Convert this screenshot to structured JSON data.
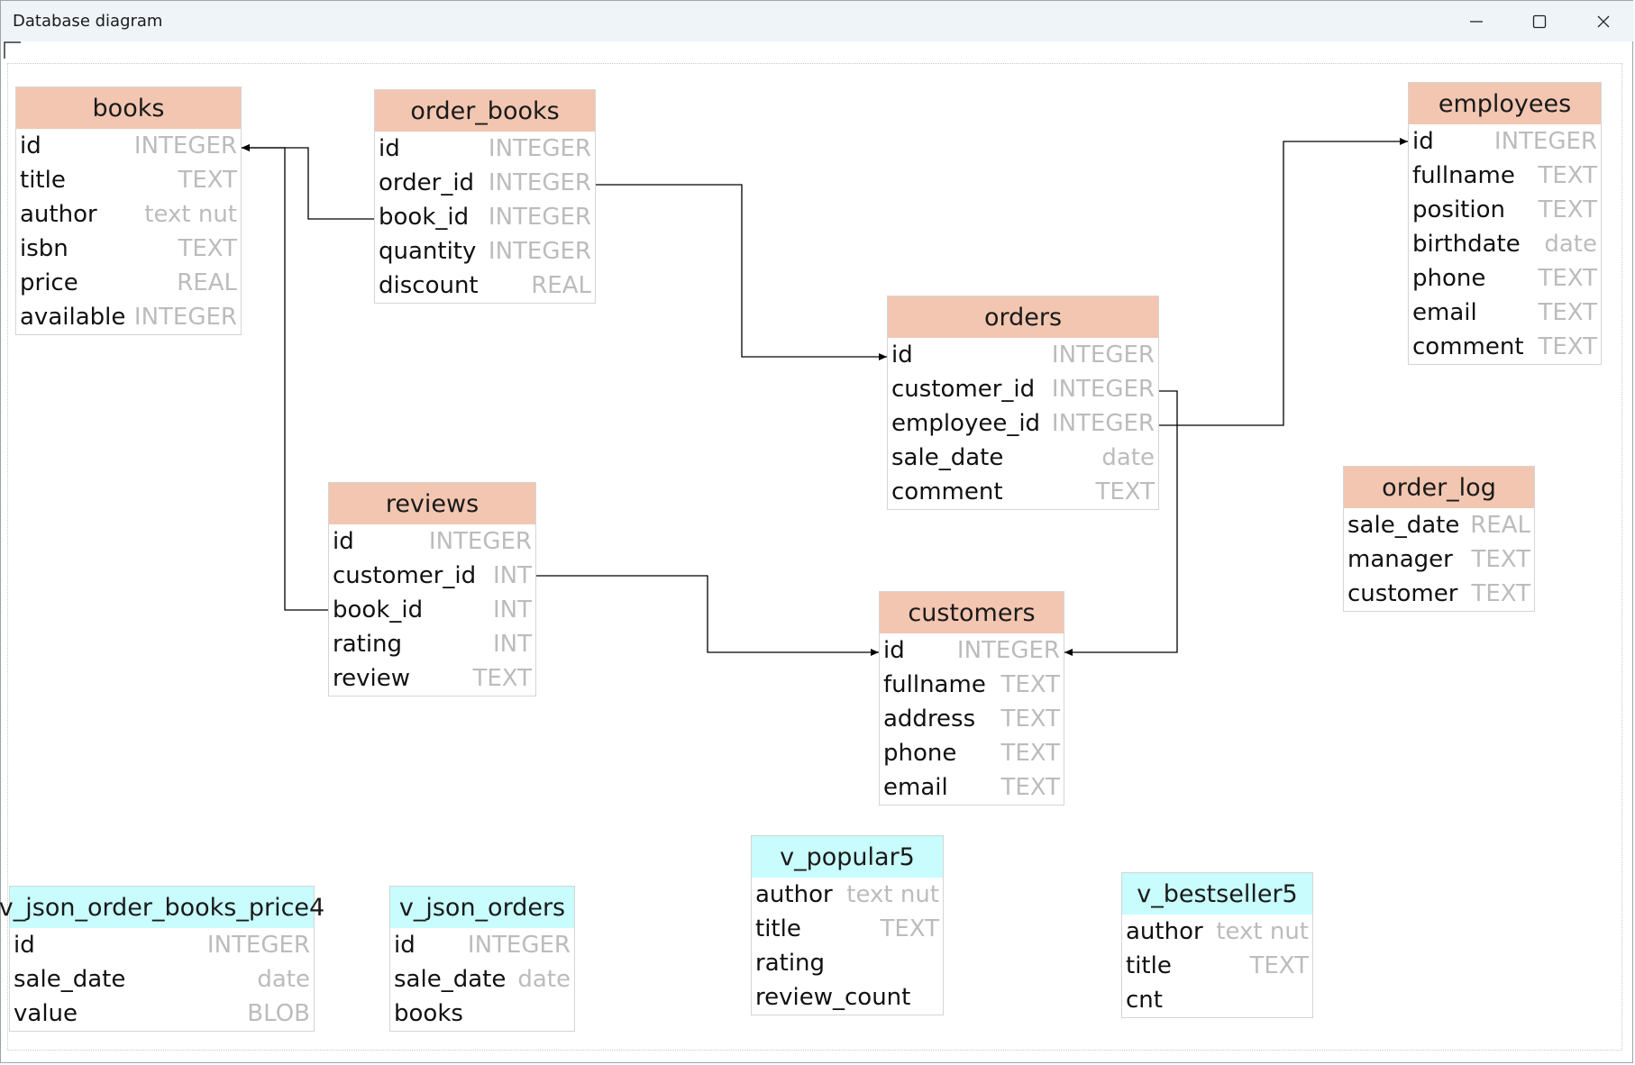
{
  "window": {
    "title": "Database diagram"
  },
  "tables": [
    {
      "key": "books",
      "kind": "table",
      "name": "books",
      "columns": [
        {
          "name": "id",
          "type": "INTEGER"
        },
        {
          "name": "title",
          "type": "TEXT"
        },
        {
          "name": "author",
          "type": "text nut"
        },
        {
          "name": "isbn",
          "type": "TEXT"
        },
        {
          "name": "price",
          "type": "REAL"
        },
        {
          "name": "available",
          "type": "INTEGER"
        }
      ]
    },
    {
      "key": "order_books",
      "kind": "table",
      "name": "order_books",
      "columns": [
        {
          "name": "id",
          "type": "INTEGER"
        },
        {
          "name": "order_id",
          "type": "INTEGER"
        },
        {
          "name": "book_id",
          "type": "INTEGER"
        },
        {
          "name": "quantity",
          "type": "INTEGER"
        },
        {
          "name": "discount",
          "type": "REAL"
        }
      ]
    },
    {
      "key": "employees",
      "kind": "table",
      "name": "employees",
      "columns": [
        {
          "name": "id",
          "type": "INTEGER"
        },
        {
          "name": "fullname",
          "type": "TEXT"
        },
        {
          "name": "position",
          "type": "TEXT"
        },
        {
          "name": "birthdate",
          "type": "date"
        },
        {
          "name": "phone",
          "type": "TEXT"
        },
        {
          "name": "email",
          "type": "TEXT"
        },
        {
          "name": "comment",
          "type": "TEXT"
        }
      ]
    },
    {
      "key": "orders",
      "kind": "table",
      "name": "orders",
      "columns": [
        {
          "name": "id",
          "type": "INTEGER"
        },
        {
          "name": "customer_id",
          "type": "INTEGER"
        },
        {
          "name": "employee_id",
          "type": "INTEGER"
        },
        {
          "name": "sale_date",
          "type": "date"
        },
        {
          "name": "comment",
          "type": "TEXT"
        }
      ]
    },
    {
      "key": "reviews",
      "kind": "table",
      "name": "reviews",
      "columns": [
        {
          "name": "id",
          "type": "INTEGER"
        },
        {
          "name": "customer_id",
          "type": "INT"
        },
        {
          "name": "book_id",
          "type": "INT"
        },
        {
          "name": "rating",
          "type": "INT"
        },
        {
          "name": "review",
          "type": "TEXT"
        }
      ]
    },
    {
      "key": "order_log",
      "kind": "table",
      "name": "order_log",
      "columns": [
        {
          "name": "sale_date",
          "type": "REAL"
        },
        {
          "name": "manager",
          "type": "TEXT"
        },
        {
          "name": "customer",
          "type": "TEXT"
        }
      ]
    },
    {
      "key": "customers",
      "kind": "table",
      "name": "customers",
      "columns": [
        {
          "name": "id",
          "type": "INTEGER"
        },
        {
          "name": "fullname",
          "type": "TEXT"
        },
        {
          "name": "address",
          "type": "TEXT"
        },
        {
          "name": "phone",
          "type": "TEXT"
        },
        {
          "name": "email",
          "type": "TEXT"
        }
      ]
    },
    {
      "key": "v_popular5",
      "kind": "view",
      "name": "v_popular5",
      "columns": [
        {
          "name": "author",
          "type": "text nut"
        },
        {
          "name": "title",
          "type": "TEXT"
        },
        {
          "name": "rating",
          "type": ""
        },
        {
          "name": "review_count",
          "type": ""
        }
      ]
    },
    {
      "key": "v_bestseller5",
      "kind": "view",
      "name": "v_bestseller5",
      "columns": [
        {
          "name": "author",
          "type": "text nut"
        },
        {
          "name": "title",
          "type": "TEXT"
        },
        {
          "name": "cnt",
          "type": ""
        }
      ]
    },
    {
      "key": "v_json_order_books_price4",
      "kind": "view",
      "name": "v_json_order_books_price4",
      "columns": [
        {
          "name": "id",
          "type": "INTEGER"
        },
        {
          "name": "sale_date",
          "type": "date"
        },
        {
          "name": "value",
          "type": "BLOB"
        }
      ]
    },
    {
      "key": "v_json_orders",
      "kind": "view",
      "name": "v_json_orders",
      "columns": [
        {
          "name": "id",
          "type": "INTEGER"
        },
        {
          "name": "sale_date",
          "type": "date"
        },
        {
          "name": "books",
          "type": ""
        }
      ]
    }
  ],
  "relations": [
    {
      "from": "order_books.book_id",
      "to": "books.id"
    },
    {
      "from": "order_books.order_id",
      "to": "orders.id"
    },
    {
      "from": "orders.employee_id",
      "to": "employees.id"
    },
    {
      "from": "orders.customer_id",
      "to": "customers.id"
    },
    {
      "from": "reviews.book_id",
      "to": "books.id"
    },
    {
      "from": "reviews.customer_id",
      "to": "customers.id"
    }
  ]
}
